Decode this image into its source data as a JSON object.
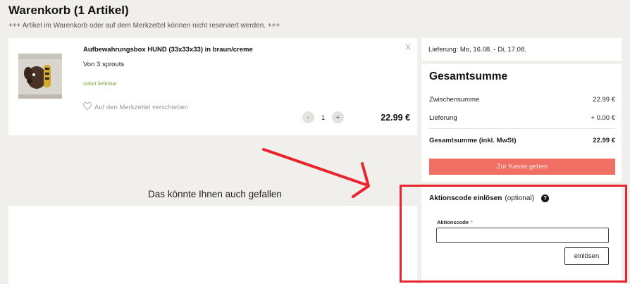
{
  "header": {
    "title": "Warenkorb (1 Artikel)",
    "notice": "+++ Artikel im Warenkorb oder auf dem Merkzettel können nicht reserviert werden. +++"
  },
  "cart_item": {
    "name": "Aufbewahrungsbox HUND (33x33x33) in braun/creme",
    "vendor": "Von 3 sprouts",
    "stock": "sofort lieferbar",
    "wishlist_label": "Auf den Merkzettel verschieben",
    "remove_label": "X",
    "qty_minus": "-",
    "qty_plus": "+",
    "quantity": "1",
    "price": "22.99 €",
    "image_icon": "dog-storage-box-image"
  },
  "delivery": {
    "text": "Lieferung: Mo, 16.08. - Di, 17.08."
  },
  "summary": {
    "title": "Gesamtsumme",
    "subtotal_label": "Zwischensumme",
    "subtotal_value": "22.99 €",
    "shipping_label": "Lieferung",
    "shipping_value": "+ 0.00 €",
    "total_label": "Gesamtsumme (inkl. MwSt)",
    "total_value": "22.99 €",
    "checkout_label": "Zur Kasse gehen"
  },
  "recommendations": {
    "title": "Das könnte Ihnen auch gefallen"
  },
  "promo": {
    "title_bold": "Aktionscode einlösen",
    "title_optional": "(optional)",
    "help_glyph": "?",
    "field_label": "Aktionscode",
    "required_mark": "*",
    "input_value": "",
    "redeem_label": "einlösen"
  },
  "colors": {
    "accent_button": "#f06e62",
    "highlight": "#e8252f",
    "stock_green": "#7aa33a",
    "page_bg": "#f1efec"
  }
}
